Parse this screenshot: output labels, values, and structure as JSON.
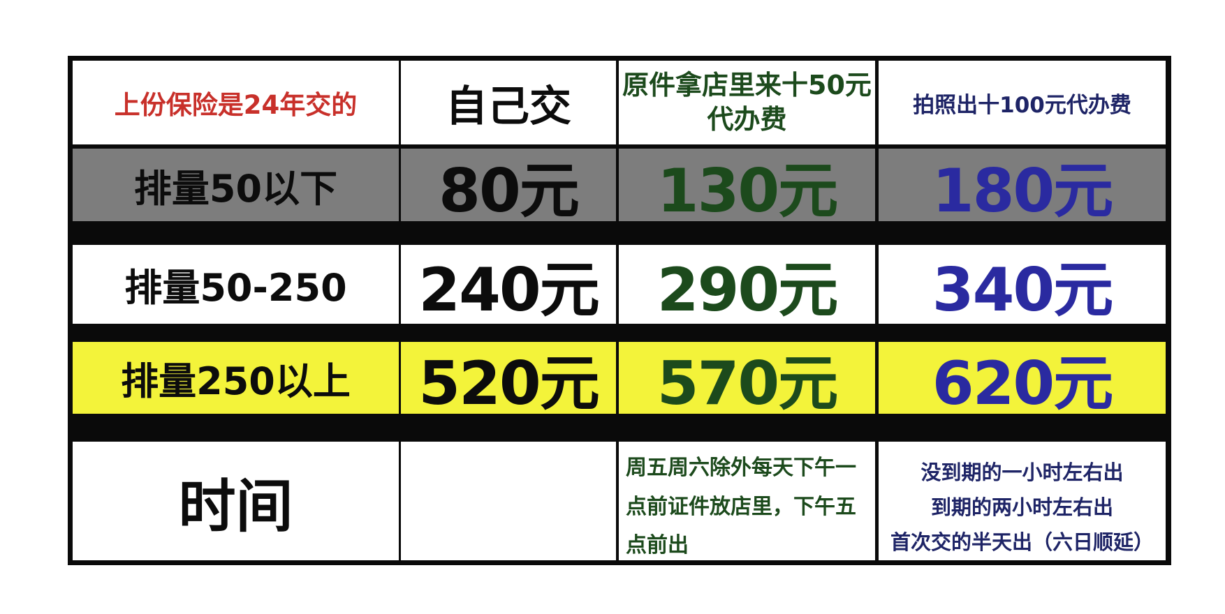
{
  "table": {
    "header": [
      "上份保险是24年交的",
      "自己交",
      "原件拿店里来十50元代办费",
      "拍照出十100元代办费"
    ],
    "rows": [
      {
        "label": "排量50以下",
        "self": "80元",
        "store": "130元",
        "photo": "180元"
      },
      {
        "label": "排量50-250",
        "self": "240元",
        "store": "290元",
        "photo": "340元"
      },
      {
        "label": "排量250以上",
        "self": "520元",
        "store": "570元",
        "photo": "620元"
      }
    ],
    "time_row": {
      "label": "时间",
      "self": "",
      "store": "周五周六除外每天下午一点前证件放店里，下午五点前出",
      "photo_lines": [
        "没到期的一小时左右出",
        "到期的两小时左右出",
        "首次交的半天出（六日顺延）"
      ]
    }
  },
  "colors": {
    "header_red": "#c8302a",
    "store_green": "#1c4a1c",
    "photo_blue": "#2a2aa0",
    "row_gray": "#7d7d7d",
    "row_yellow": "#f3f33a"
  }
}
